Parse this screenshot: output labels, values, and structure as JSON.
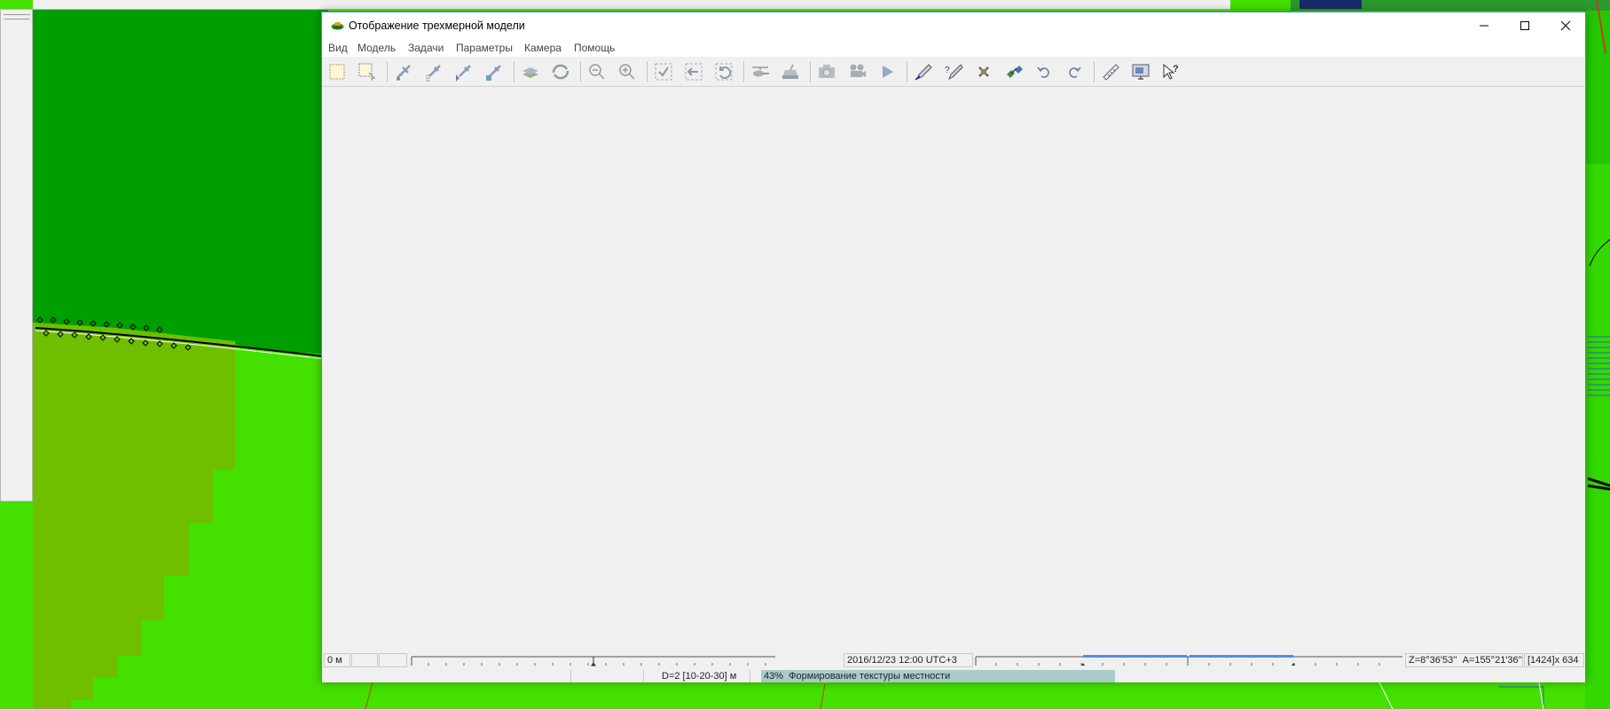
{
  "window": {
    "title": "Отображение трехмерной модели",
    "controls": {
      "minimize": "minimize-icon",
      "maximize": "maximize-icon",
      "close": "close-icon"
    }
  },
  "menu": {
    "items": [
      "Вид",
      "Модель",
      "Задачи",
      "Параметры",
      "Камера",
      "Помощь"
    ]
  },
  "toolbar": {
    "icons": [
      "select-frame-icon",
      "select-area-icon",
      "aircraft-add-icon",
      "aircraft-list-icon",
      "aircraft-route-icon",
      "aircraft-target-icon",
      "layers-icon",
      "refresh-layers-icon",
      "zoom-out-icon",
      "zoom-in-icon",
      "check-frame-icon",
      "back-frame-icon",
      "undo-frame-icon",
      "helicopter-icon",
      "vehicle-icon",
      "camera-icon",
      "movie-camera-icon",
      "play-icon",
      "pen-draw-icon",
      "pen-edit-icon",
      "delete-point-icon",
      "satellite-icon",
      "undo-icon",
      "redo-icon",
      "ruler-icon",
      "monitor-icon",
      "help-pointer-icon"
    ]
  },
  "status": {
    "distance": "0 м",
    "datetime": "2016/12/23  12:00  UTC+3",
    "zenith": "Z=8°36'53''",
    "azimuth": "A=155°21'36''",
    "resolution": "[1424]x 634",
    "depth": "D=2 [10-20-30] м",
    "progress_percent": "43%",
    "progress_text": "Формирование текстуры местности",
    "progress_value": 0.43
  },
  "colors": {
    "dark_green": "#009f00",
    "light_green": "#44e000",
    "olive": "#6fbf00",
    "progress": "#a9cbcc",
    "slider_blue": "#4a90e2",
    "window_border": "#3a8fd6"
  }
}
